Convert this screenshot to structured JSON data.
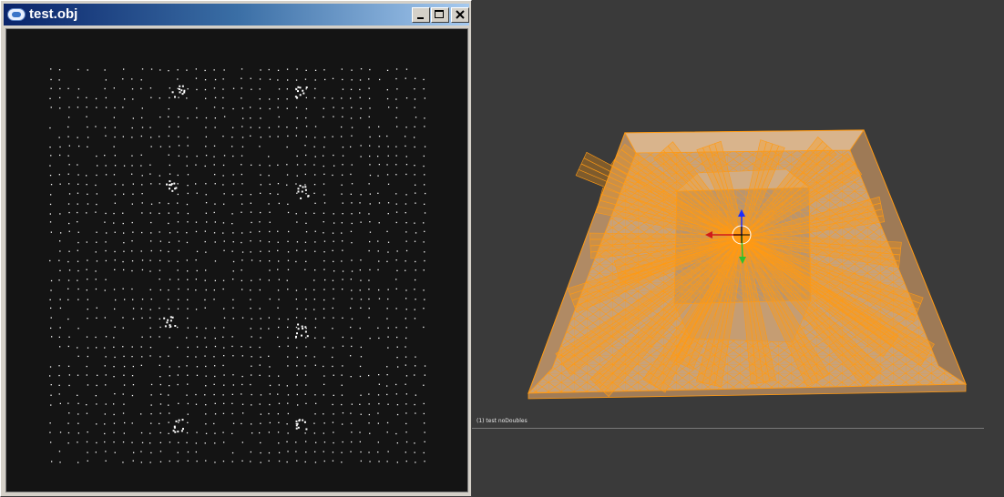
{
  "window": {
    "title": "test.obj",
    "controls": {
      "minimize": "minimize",
      "maximize": "maximize",
      "close": "close"
    }
  },
  "viewport_3d": {
    "object_label": "(1) test noDoubles",
    "colors": {
      "background": "#3a3a3a",
      "mesh_fill": "#c8a27a",
      "wire": "#ff9a14",
      "axis_z": "#1a2cff",
      "axis_x": "#d01a1a",
      "axis_y": "#2ec02e"
    }
  },
  "point_cloud": {
    "background": "#141414",
    "point_color": "#ffffff"
  }
}
